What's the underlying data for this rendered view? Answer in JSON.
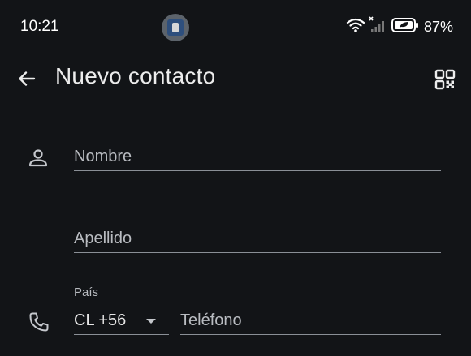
{
  "status_bar": {
    "time": "10:21",
    "battery": "87%",
    "icons": [
      "wifi-icon",
      "no-signal-icon",
      "battery-saver-icon"
    ]
  },
  "app_bar": {
    "title": "Nuevo contacto",
    "back_icon": "arrow-back-icon",
    "qr_icon": "qr-code-icon"
  },
  "form": {
    "first_name": {
      "placeholder": "Nombre",
      "value": ""
    },
    "last_name": {
      "placeholder": "Apellido",
      "value": ""
    },
    "country": {
      "label": "País",
      "value": "CL +56"
    },
    "phone": {
      "placeholder": "Teléfono",
      "value": ""
    }
  },
  "colors": {
    "background": "#121417",
    "text": "#e6e6e6",
    "placeholder": "#b9bcc1",
    "underline": "#8a8f96"
  }
}
